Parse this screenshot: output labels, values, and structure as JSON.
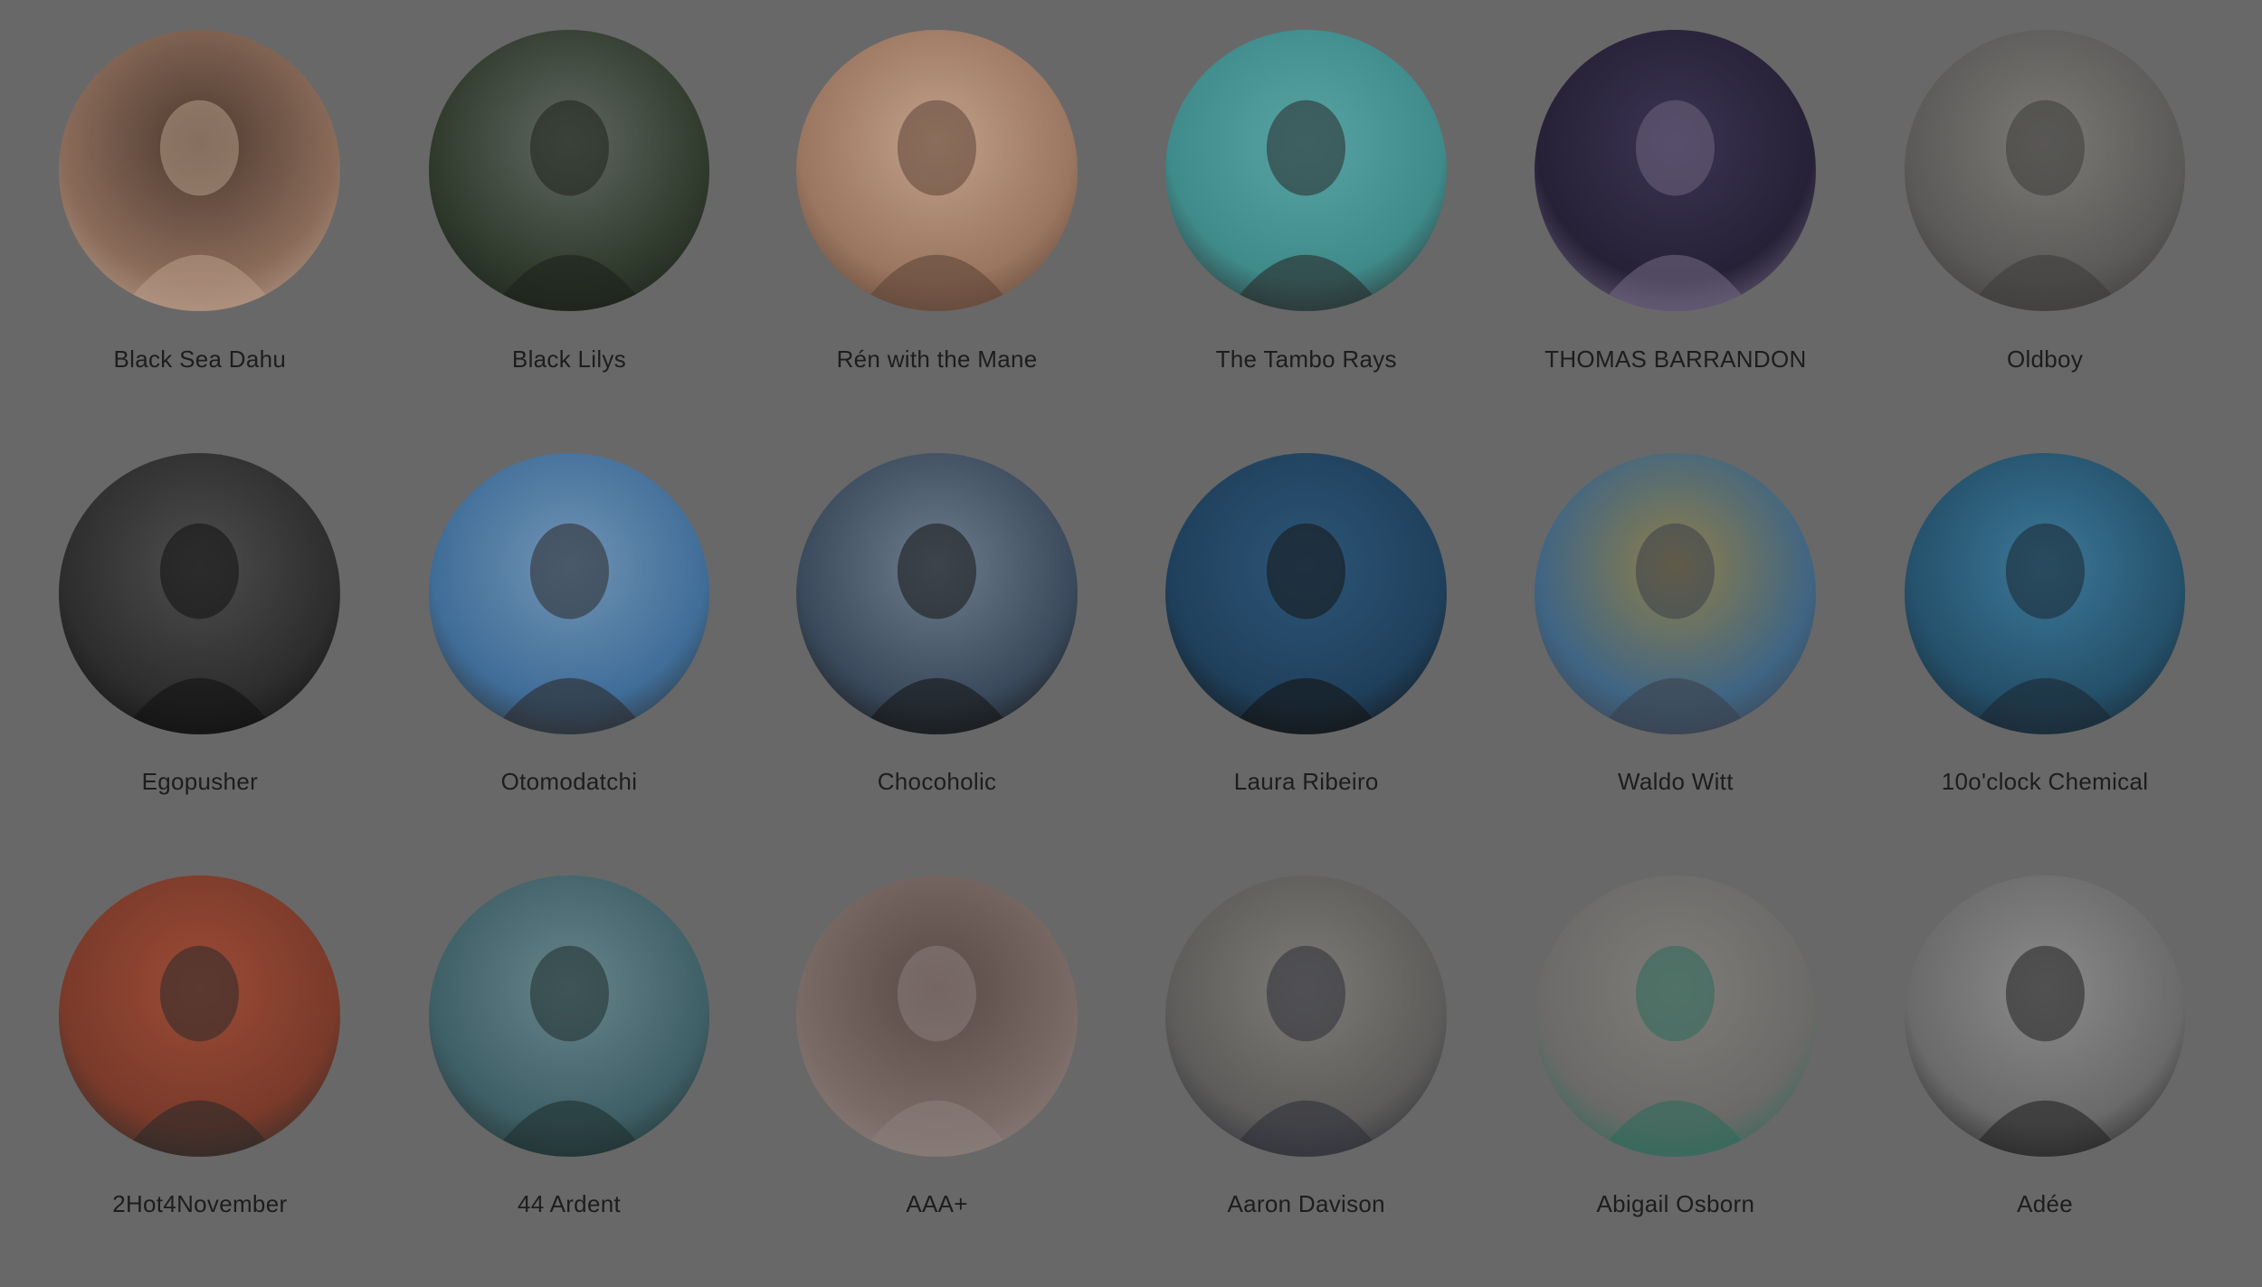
{
  "artists": [
    {
      "name": "Black Sea Dahu",
      "palette": [
        "#8a6b5a",
        "#4d3a2e",
        "#b59a86"
      ]
    },
    {
      "name": "Black Lilys",
      "palette": [
        "#2f3a2c",
        "#606860",
        "#1d221b"
      ]
    },
    {
      "name": "Rén with the Mane",
      "palette": [
        "#9a7560",
        "#c2a08a",
        "#5d4437"
      ]
    },
    {
      "name": "The Tambo Rays",
      "palette": [
        "#3f8a8a",
        "#58a3a3",
        "#2a2a2a"
      ]
    },
    {
      "name": "THOMAS BARRANDON",
      "palette": [
        "#262136",
        "#3a3454",
        "#6f6580"
      ]
    },
    {
      "name": "Oldboy",
      "palette": [
        "#5b5a58",
        "#7a7976",
        "#3d3c3a"
      ]
    },
    {
      "name": "Egopusher",
      "palette": [
        "#2d2d2d",
        "#4d4d4d",
        "#111111"
      ]
    },
    {
      "name": "Otomodatchi",
      "palette": [
        "#3f6d98",
        "#7193b4",
        "#2b2a2a"
      ]
    },
    {
      "name": "Chocoholic",
      "palette": [
        "#3a4a5c",
        "#6c7c8c",
        "#151515"
      ]
    },
    {
      "name": "Laura Ribeiro",
      "palette": [
        "#1f405c",
        "#2d5577",
        "#141414"
      ]
    },
    {
      "name": "Waldo Witt",
      "palette": [
        "#3f6584",
        "#8d7d4a",
        "#3a3f4a"
      ]
    },
    {
      "name": "10o'clock Chemical",
      "palette": [
        "#24506a",
        "#3c7898",
        "#1a2630"
      ]
    },
    {
      "name": "2Hot4November",
      "palette": [
        "#7a3a2a",
        "#9a4b36",
        "#2a2a2a"
      ]
    },
    {
      "name": "44 Ardent",
      "palette": [
        "#3f5f66",
        "#67848a",
        "#1e2e2e"
      ]
    },
    {
      "name": "AAA+",
      "palette": [
        "#7a6a66",
        "#5a4a46",
        "#8a7e7a"
      ]
    },
    {
      "name": "Aaron Davison",
      "palette": [
        "#5d5c5a",
        "#7c7a76",
        "#2e3038"
      ]
    },
    {
      "name": "Abigail Osborn",
      "palette": [
        "#6b6a68",
        "#7d7c79",
        "#2d6a5a"
      ]
    },
    {
      "name": "Adée",
      "palette": [
        "#6a6a6a",
        "#8a8a8a",
        "#232323"
      ]
    }
  ],
  "colors": {
    "background": "#686868",
    "text": "#1d1d1d"
  }
}
